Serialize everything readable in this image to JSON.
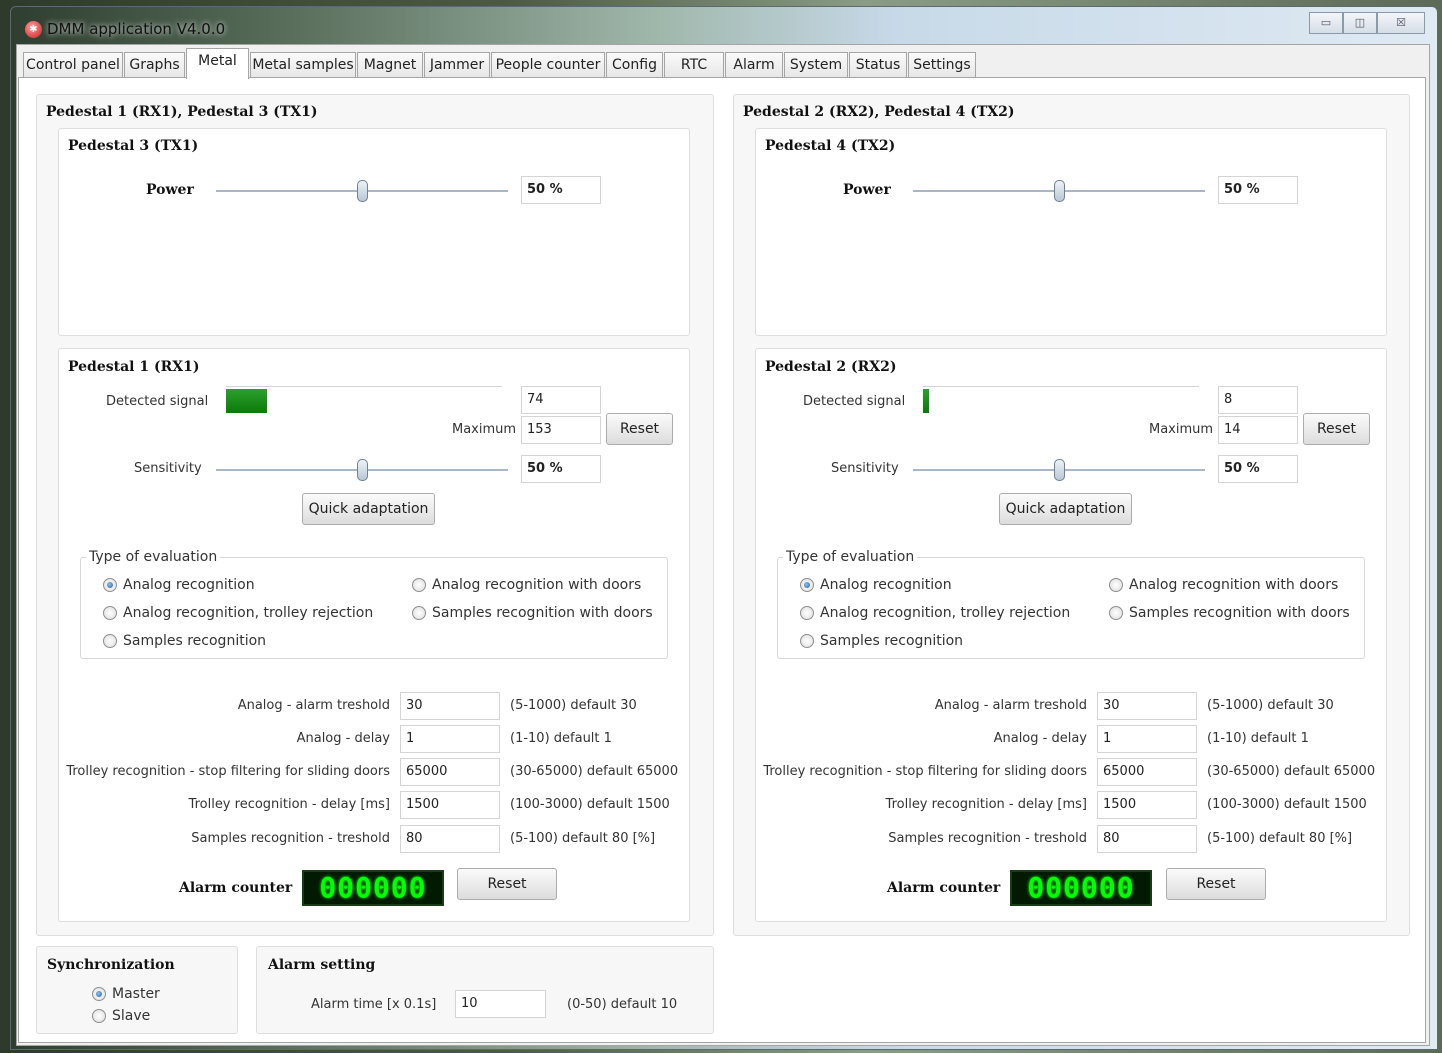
{
  "window": {
    "title": "DMM application V4.0.0",
    "buttons": {
      "minimize": "▭",
      "maximize": "◫",
      "close": "☒"
    }
  },
  "tabs": [
    "Control panel",
    "Graphs",
    "Metal",
    "Metal samples",
    "Magnet",
    "Jammer",
    "People counter",
    "Config",
    "RTC",
    "Alarm",
    "System",
    "Status",
    "Settings"
  ],
  "active_tab": "Metal",
  "left": {
    "title": "Pedestal 1 (RX1), Pedestal 3 (TX1)",
    "tx": {
      "title": "Pedestal 3 (TX1)",
      "power_label": "Power",
      "power_value": "50 %",
      "power_fraction": 0.5
    },
    "rx": {
      "title": "Pedestal 1 (RX1)",
      "detected_label": "Detected signal",
      "detected_value": "74",
      "detected_fraction": 0.15,
      "maximum_label": "Maximum",
      "maximum_value": "153",
      "reset_label": "Reset",
      "sensitivity_label": "Sensitivity",
      "sensitivity_value": "50 %",
      "sensitivity_fraction": 0.5,
      "quick_label": "Quick adaptation",
      "eval": {
        "title": "Type of evaluation",
        "options": [
          "Analog recognition",
          "Analog recognition with doors",
          "Analog recognition, trolley rejection",
          "Samples recognition with doors",
          "Samples recognition"
        ],
        "selected": "Analog recognition"
      },
      "params": [
        {
          "label": "Analog - alarm treshold",
          "value": "30",
          "hint": "(5-1000) default 30"
        },
        {
          "label": "Analog - delay",
          "value": "1",
          "hint": "(1-10) default 1"
        },
        {
          "label": "Trolley recognition - stop filtering for sliding doors",
          "value": "65000",
          "hint": "(30-65000) default 65000"
        },
        {
          "label": "Trolley recognition - delay [ms]",
          "value": "1500",
          "hint": "(100-3000) default 1500"
        },
        {
          "label": "Samples recognition - treshold",
          "value": "80",
          "hint": "(5-100) default 80 [%]"
        }
      ],
      "alarm_counter_label": "Alarm counter",
      "alarm_counter_value": "000000",
      "counter_reset_label": "Reset"
    }
  },
  "right": {
    "title": "Pedestal 2 (RX2), Pedestal 4 (TX2)",
    "tx": {
      "title": "Pedestal 4 (TX2)",
      "power_label": "Power",
      "power_value": "50 %",
      "power_fraction": 0.5
    },
    "rx": {
      "title": "Pedestal 2 (RX2)",
      "detected_label": "Detected signal",
      "detected_value": "8",
      "detected_fraction": 0.02,
      "maximum_label": "Maximum",
      "maximum_value": "14",
      "reset_label": "Reset",
      "sensitivity_label": "Sensitivity",
      "sensitivity_value": "50 %",
      "sensitivity_fraction": 0.5,
      "quick_label": "Quick adaptation",
      "eval": {
        "title": "Type of evaluation",
        "options": [
          "Analog recognition",
          "Analog recognition with doors",
          "Analog recognition, trolley rejection",
          "Samples recognition with doors",
          "Samples recognition"
        ],
        "selected": "Analog recognition"
      },
      "params": [
        {
          "label": "Analog - alarm treshold",
          "value": "30",
          "hint": "(5-1000) default 30"
        },
        {
          "label": "Analog - delay",
          "value": "1",
          "hint": "(1-10) default 1"
        },
        {
          "label": "Trolley recognition - stop filtering for sliding doors",
          "value": "65000",
          "hint": "(30-65000) default 65000"
        },
        {
          "label": "Trolley recognition - delay [ms]",
          "value": "1500",
          "hint": "(100-3000) default 1500"
        },
        {
          "label": "Samples recognition - treshold",
          "value": "80",
          "hint": "(5-100) default 80 [%]"
        }
      ],
      "alarm_counter_label": "Alarm counter",
      "alarm_counter_value": "000000",
      "counter_reset_label": "Reset"
    }
  },
  "sync": {
    "title": "Synchronization",
    "options": [
      "Master",
      "Slave"
    ],
    "selected": "Master"
  },
  "alarm_setting": {
    "title": "Alarm setting",
    "time_label": "Alarm time [x 0.1s]",
    "time_value": "10",
    "hint": "(0-50) default 10"
  },
  "colors": {
    "progress": "#1a8f1a",
    "counter_bg": "#021a02",
    "counter_fg": "#00ff00",
    "selection": "#1d5fa8"
  }
}
